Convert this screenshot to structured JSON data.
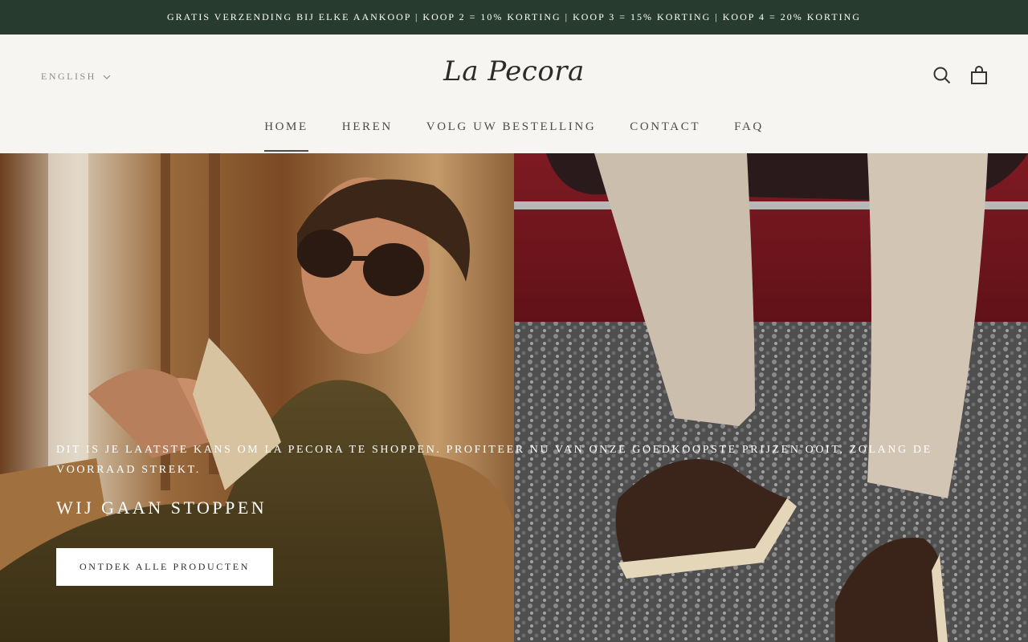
{
  "announcement": {
    "text": "GRATIS VERZENDING BIJ ELKE AANKOOP | KOOP 2 = 10% KORTING | KOOP 3 = 15% KORTING | KOOP 4 = 20% KORTING"
  },
  "header": {
    "language": "ENGLISH",
    "logo": "La Pecora",
    "icons": {
      "search": "search-icon",
      "cart": "shopping-bag-icon",
      "language_dropdown": "chevron-down-icon"
    }
  },
  "nav": {
    "items": [
      {
        "label": "HOME",
        "active": true
      },
      {
        "label": "HEREN"
      },
      {
        "label": "VOLG UW BESTELLING"
      },
      {
        "label": "CONTACT"
      },
      {
        "label": "FAQ"
      }
    ]
  },
  "hero": {
    "subtitle": "DIT IS JE LAATSTE KANS OM LA PECORA TE SHOPPEN. PROFITEER NU VAN ONZE GOEDKOOPSTE PRIJZEN OOIT, ZOLANG DE VOORRAAD STREKT.",
    "title": "WIJ GAAN STOPPEN",
    "button": "ONTDEK ALLE PRODUCTEN"
  },
  "colors": {
    "announcement_bg": "#273b2f",
    "header_bg": "#f6f5f2",
    "text_dark": "#4c4c4c",
    "button_bg": "#ffffff"
  }
}
